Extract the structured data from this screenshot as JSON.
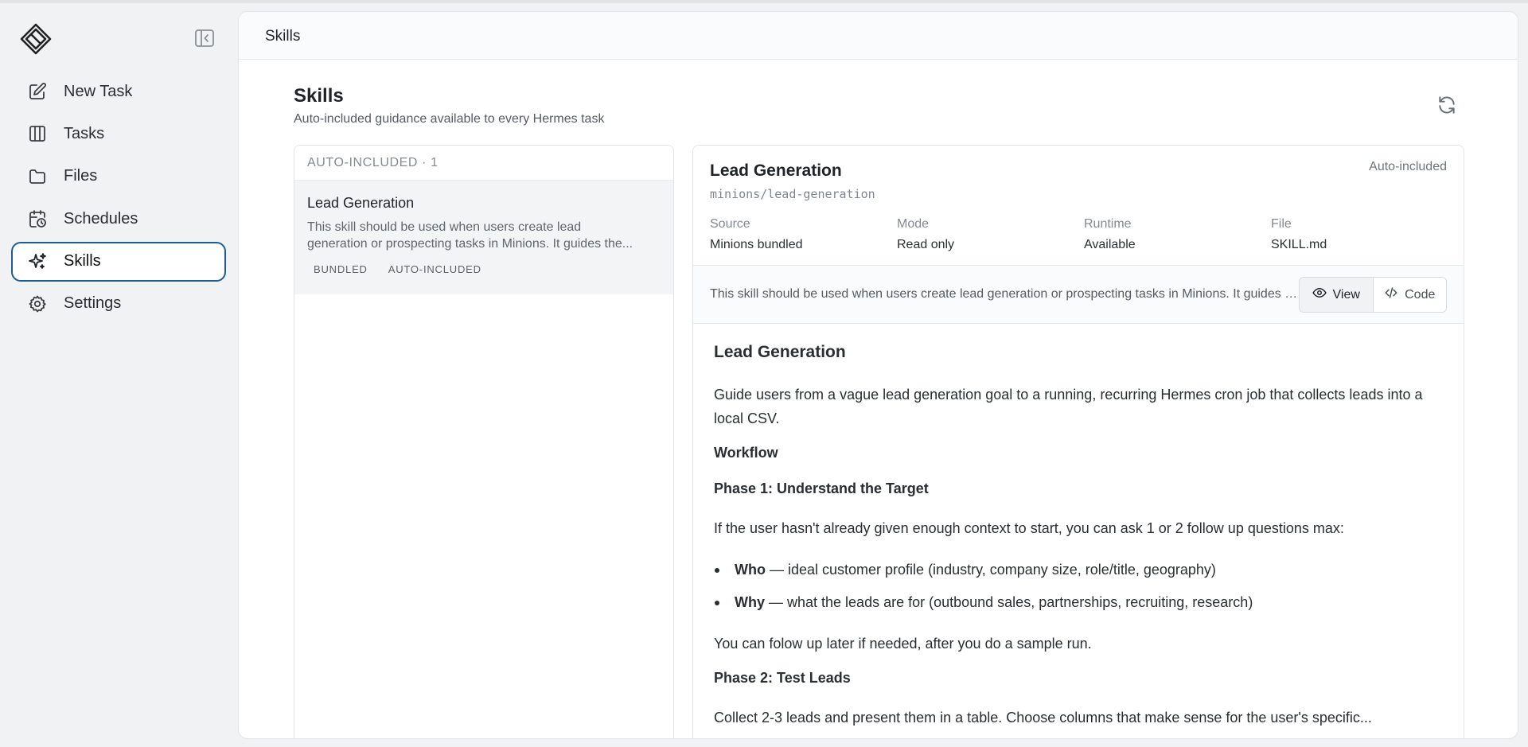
{
  "sidebar": {
    "items": [
      {
        "label": "New Task",
        "icon": "edit-icon"
      },
      {
        "label": "Tasks",
        "icon": "columns-icon"
      },
      {
        "label": "Files",
        "icon": "folder-icon"
      },
      {
        "label": "Schedules",
        "icon": "calendar-clock-icon"
      },
      {
        "label": "Skills",
        "icon": "sparkles-icon",
        "active": true
      },
      {
        "label": "Settings",
        "icon": "gear-icon"
      }
    ]
  },
  "header": {
    "title": "Skills"
  },
  "page": {
    "title": "Skills",
    "subtitle": "Auto-included guidance available to every Hermes task"
  },
  "list": {
    "heading": "AUTO-INCLUDED · 1",
    "items": [
      {
        "title": "Lead Generation",
        "desc_line1": "This skill should be used when users create lead",
        "desc_line2": "generation or prospecting tasks in Minions. It guides the...",
        "tags": [
          "BUNDLED",
          "AUTO-INCLUDED"
        ]
      }
    ]
  },
  "detail": {
    "title": "Lead Generation",
    "path": "minions/lead-generation",
    "badge": "Auto-included",
    "meta": [
      {
        "key": "Source",
        "value": "Minions bundled"
      },
      {
        "key": "Mode",
        "value": "Read only"
      },
      {
        "key": "Runtime",
        "value": "Available"
      },
      {
        "key": "File",
        "value": "SKILL.md"
      }
    ],
    "summary": "This skill should be used when users create lead generation or prospecting tasks in Minions. It guides the...",
    "toggle": {
      "view": "View",
      "code": "Code"
    },
    "doc": {
      "h1": "Lead Generation",
      "intro": "Guide users from a vague lead generation goal to a running, recurring Hermes cron job that collects leads into a local CSV.",
      "workflow": "Workflow",
      "phase1": "Phase 1: Understand the Target",
      "phase1_text": "If the user hasn't already given enough context to start, you can ask 1 or 2 follow up questions max:",
      "bullets": [
        {
          "bold": "Who",
          "text": " — ideal customer profile (industry, company size, role/title, geography)"
        },
        {
          "bold": "Why",
          "text": " — what the leads are for (outbound sales, partnerships, recruiting, research)"
        }
      ],
      "followup": "You can folow up later if needed, after you do a sample run.",
      "phase2": "Phase 2: Test Leads",
      "phase2_text": "Collect 2-3 leads and present them in a table. Choose columns that make sense for the user's specific..."
    }
  },
  "colors": {
    "accent": "#1e5b92",
    "page_bg": "#f1f2f4"
  }
}
